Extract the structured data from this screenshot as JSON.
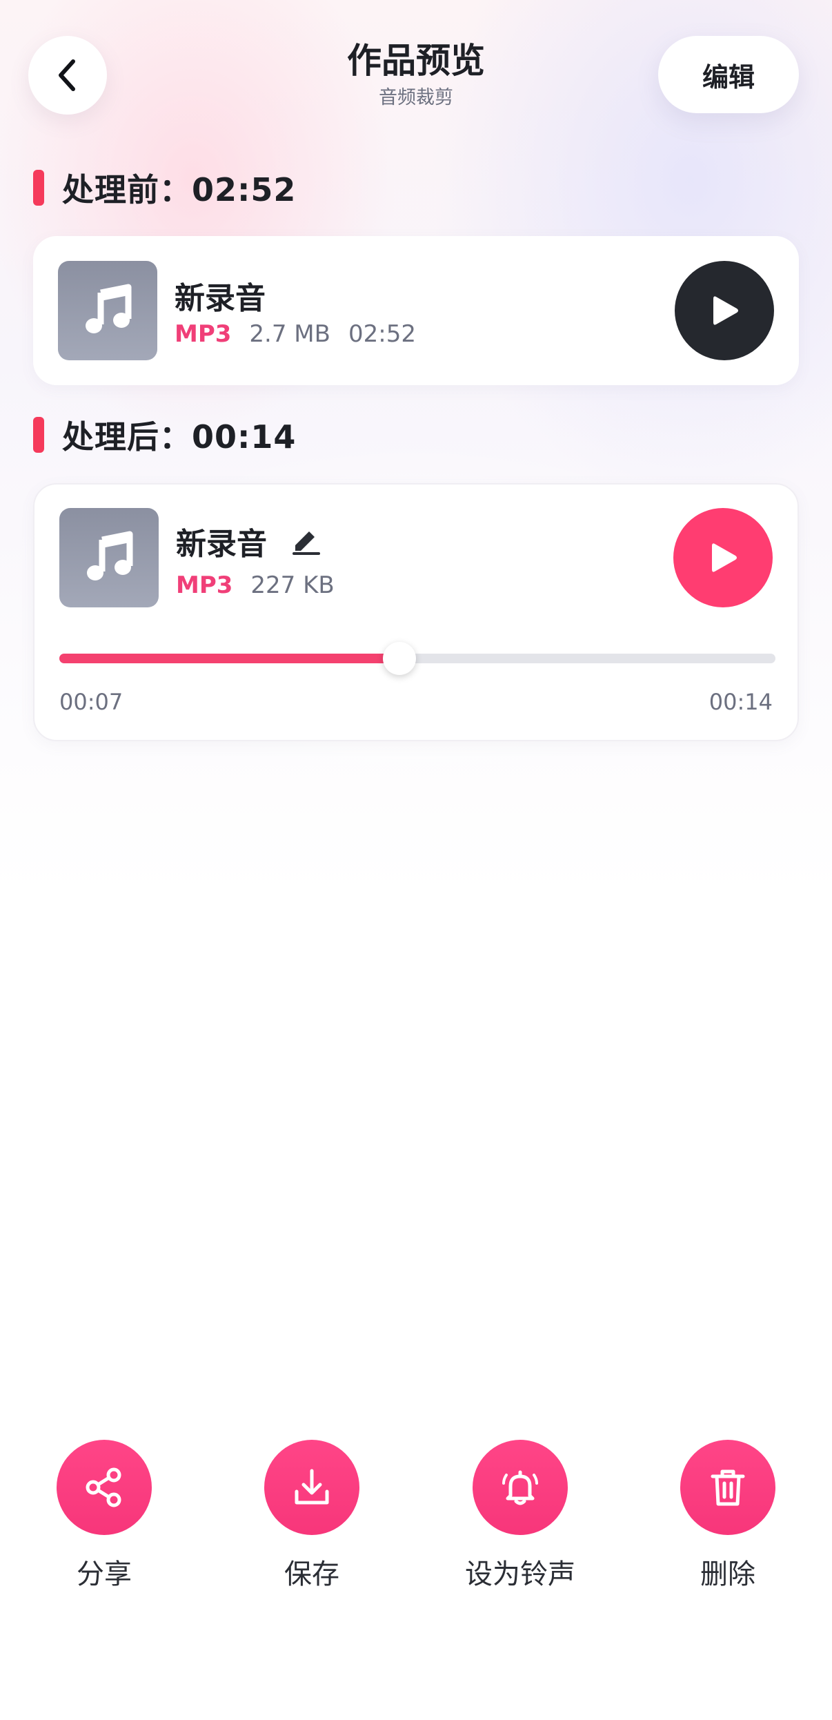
{
  "header": {
    "back_icon": "chevron-left-icon",
    "title": "作品预览",
    "subtitle": "音频裁剪",
    "edit_label": "编辑"
  },
  "before": {
    "section_label": "处理前：02:52",
    "file": {
      "name": "新录音",
      "format": "MP3",
      "size": "2.7 MB",
      "duration": "02:52",
      "thumb_icon": "music-note-icon",
      "play_icon": "play-icon"
    }
  },
  "after": {
    "section_label": "处理后：00:14",
    "file": {
      "name": "新录音",
      "format": "MP3",
      "size": "227 KB",
      "thumb_icon": "music-note-icon",
      "rename_icon": "pencil-icon",
      "play_icon": "play-icon"
    },
    "player": {
      "current_time": "00:07",
      "total_time": "00:14",
      "progress": 0.475
    }
  },
  "actions": [
    {
      "label": "分享",
      "icon": "share-icon"
    },
    {
      "label": "保存",
      "icon": "download-icon"
    },
    {
      "label": "设为铃声",
      "icon": "bell-icon"
    },
    {
      "label": "删除",
      "icon": "trash-icon"
    }
  ],
  "colors": {
    "accent": "#ff3d71",
    "accent_bar": "#f53a5b",
    "format_text": "#f03f78",
    "dark_button": "#25282e"
  }
}
